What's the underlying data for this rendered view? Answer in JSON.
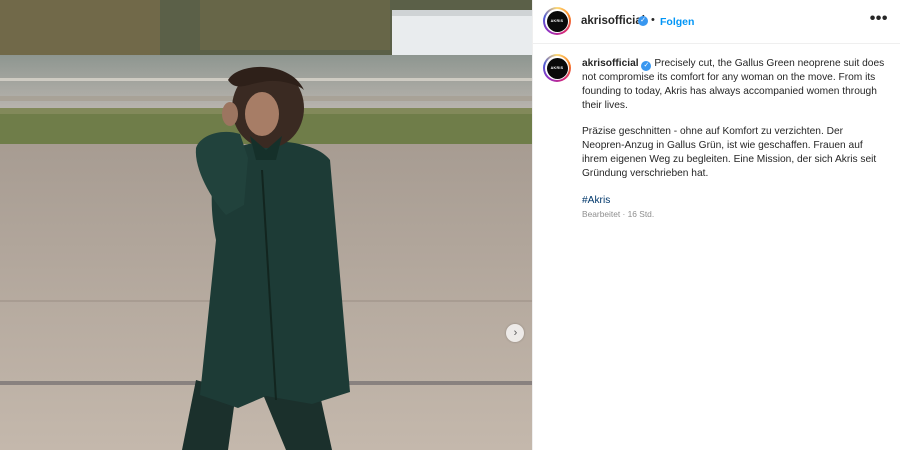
{
  "post": {
    "username": "akrisofficial",
    "avatar_text": "AKRIS",
    "separator": "•",
    "follow_label": "Folgen",
    "more_icon": "•••",
    "caption_en": "Precisely cut, the Gallus Green neoprene suit does not compromise its comfort for any woman on the move. From its founding to today, Akris has always accompanied women through their lives.",
    "caption_de": "Präzise geschnitten - ohne auf Komfort zu verzichten. Der Neopren-Anzug in Gallus Grün, ist wie geschaffen. Frauen auf ihrem eigenen Weg zu begleiten. Eine Mission, der sich Akris seit Gründung verschrieben hat.",
    "hashtag": "#Akris",
    "meta": "Bearbeitet · 16 Std."
  },
  "icons": {
    "verified": "verified-check-icon",
    "next": "chevron-right-icon",
    "more": "more-options-icon"
  },
  "colors": {
    "follow": "#0095f6",
    "verified": "#3897f0",
    "hashtag": "#00376b",
    "suit": "#1d3b36"
  }
}
